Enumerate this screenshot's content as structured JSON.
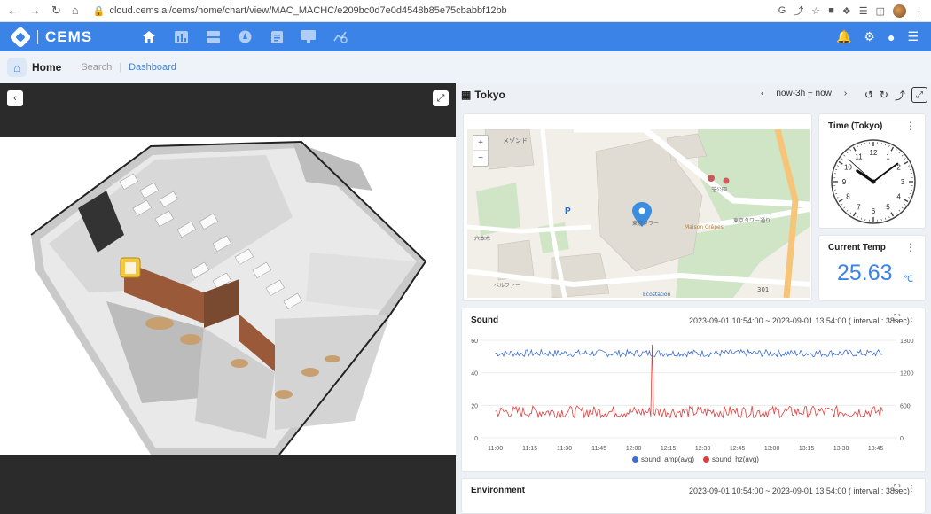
{
  "browser": {
    "url": "cloud.cems.ai/cems/home/chart/view/MAC_MACHC/e209bc0d7e0d4548b85e75cbabbf12bb"
  },
  "app": {
    "brand": "CEMS"
  },
  "breadcrumb": {
    "home": "Home",
    "search": "Search",
    "dashboard": "Dashboard"
  },
  "dashboard": {
    "title": "Tokyo",
    "range": "now-3h ~ now"
  },
  "map": {
    "labels": [
      "メゾンド",
      "東京タワー",
      "芝公園",
      "Maison Crêpes",
      "東京タワー通り",
      "Ecostation",
      "301",
      "ベルファー",
      "六本木"
    ]
  },
  "clock_card": {
    "title": "Time (Tokyo)",
    "numbers": [
      "12",
      "1",
      "2",
      "3",
      "4",
      "5",
      "6",
      "7",
      "8",
      "9",
      "10",
      "11"
    ],
    "hour": 10,
    "minute": 8,
    "second": 52
  },
  "temp_card": {
    "title": "Current Temp",
    "value": "25.63",
    "unit": "℃"
  },
  "sound_card": {
    "title": "Sound",
    "range": "2023-09-01 10:54:00 ~ 2023-09-01 13:54:00 ( interval : 38sec)"
  },
  "env_card": {
    "title": "Environment",
    "range": "2023-09-01 10:54:00 ~ 2023-09-01 13:54:00 ( interval : 38sec)"
  },
  "chart_data": {
    "type": "line",
    "x_ticks": [
      "11:00",
      "11:15",
      "11:30",
      "11:45",
      "12:00",
      "12:15",
      "12:30",
      "12:45",
      "13:00",
      "13:15",
      "13:30",
      "13:45"
    ],
    "y_left": {
      "ticks": [
        0,
        20,
        40,
        60
      ],
      "lim": [
        0,
        60
      ]
    },
    "y_right": {
      "ticks": [
        0,
        600,
        1200,
        1800
      ],
      "lim": [
        0,
        1800
      ]
    },
    "series": [
      {
        "name": "sound_amp(avg)",
        "color": "#3b6fd4",
        "axis": "left",
        "mean": 52,
        "jitter": 2.2,
        "spikes": []
      },
      {
        "name": "sound_hz(avg)",
        "color": "#e03c3c",
        "axis": "right",
        "mean": 480,
        "jitter": 110,
        "spikes": [
          {
            "t": "12:08",
            "value": 1720
          },
          {
            "t": "13:52",
            "value": 620
          }
        ]
      }
    ]
  }
}
